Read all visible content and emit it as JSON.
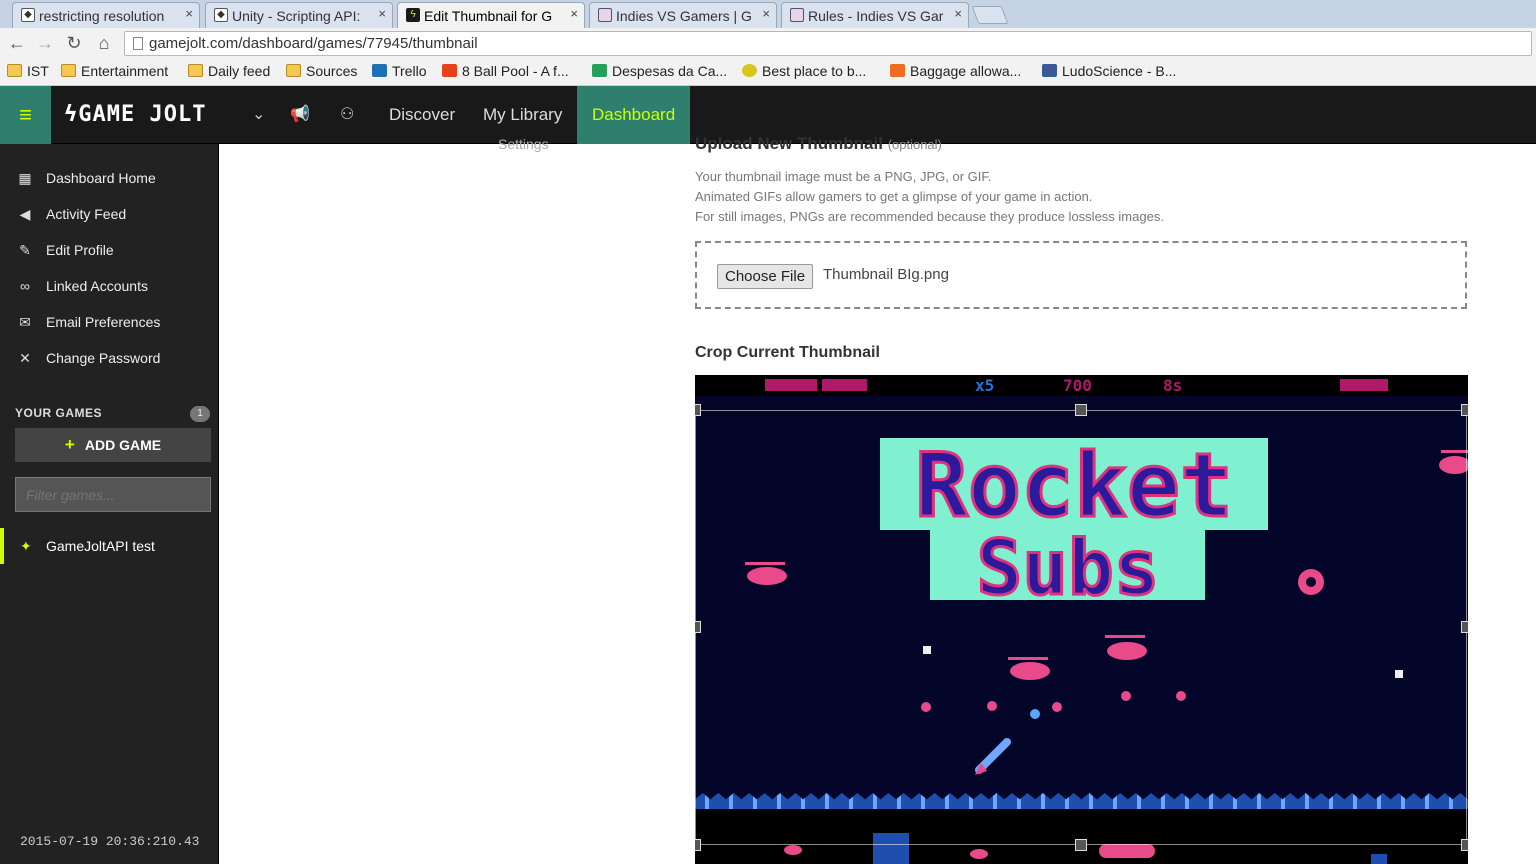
{
  "browser": {
    "tabs": [
      {
        "title": "restricting resolution",
        "favicon": "unity-icon",
        "active": false
      },
      {
        "title": "Unity - Scripting API:",
        "favicon": "unity-icon",
        "active": false
      },
      {
        "title": "Edit Thumbnail for G",
        "favicon": "gamejolt-icon",
        "active": true
      },
      {
        "title": "Indies VS Gamers | G",
        "favicon": "page-icon",
        "active": false
      },
      {
        "title": "Rules - Indies VS Gar",
        "favicon": "page-icon",
        "active": false
      }
    ],
    "close_glyph": "×",
    "url": "gamejolt.com/dashboard/games/77945/thumbnail",
    "bookmarks": [
      {
        "label": "IST",
        "icon": "folder-icon"
      },
      {
        "label": "Entertainment",
        "icon": "folder-icon"
      },
      {
        "label": "Daily feed",
        "icon": "folder-icon"
      },
      {
        "label": "Sources",
        "icon": "folder-icon"
      },
      {
        "label": "Trello",
        "icon": "trello-icon"
      },
      {
        "label": "8 Ball Pool - A f...",
        "icon": "youtube-icon"
      },
      {
        "label": "Despesas da Ca...",
        "icon": "sheets-icon"
      },
      {
        "label": "Best place to b...",
        "icon": "smiley-icon"
      },
      {
        "label": "Baggage allowa...",
        "icon": "e-icon"
      },
      {
        "label": "LudoScience - B...",
        "icon": "facebook-icon"
      }
    ]
  },
  "header": {
    "logo": "GAME JOLT",
    "nav": [
      "Discover",
      "My Library",
      "Dashboard"
    ],
    "active_nav": "Dashboard",
    "accent": "#ccff00",
    "teal": "#2f7f6f"
  },
  "sidebar": {
    "items": [
      {
        "label": "Dashboard Home",
        "icon": "dashboard-icon"
      },
      {
        "label": "Activity Feed",
        "icon": "megaphone-icon"
      },
      {
        "label": "Edit Profile",
        "icon": "pencil-icon"
      },
      {
        "label": "Linked Accounts",
        "icon": "link-icon"
      },
      {
        "label": "Email Preferences",
        "icon": "envelope-icon"
      },
      {
        "label": "Change Password",
        "icon": "wrench-icon"
      }
    ],
    "your_games_label": "YOUR GAMES",
    "games_count": "1",
    "add_game_label": "ADD GAME",
    "filter_placeholder": "Filter games...",
    "games": [
      {
        "label": "GameJoltAPI test",
        "icon": "gamepad-icon"
      }
    ]
  },
  "timestamp": "2015-07-19 20:36:210.43",
  "main": {
    "settings_cut": "Settings",
    "upload_title": "Upload New Thumbnail",
    "upload_optional": "(optional)",
    "help_lines": [
      "Your thumbnail image must be a PNG, JPG, or GIF.",
      "Animated GIFs allow gamers to get a glimpse of your game in action.",
      "For still images, PNGs are recommended because they produce lossless images."
    ],
    "choose_file_label": "Choose File",
    "file_name": "Thumbnail BIg.png",
    "crop_title": "Crop Current Thumbnail",
    "thumbnail": {
      "hud_lives": "x5",
      "hud_score": "700",
      "hud_time": "8s",
      "title_line1": "Rocket",
      "title_line2": "Subs"
    }
  }
}
